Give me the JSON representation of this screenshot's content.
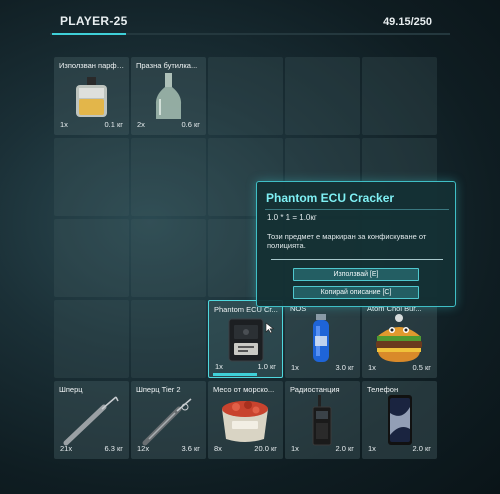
{
  "header": {
    "player_name": "PLAYER-25",
    "weight": "49.15/250"
  },
  "slots": [
    {
      "name": "Използван парфю...",
      "count": "1x",
      "weight": "0.1 кг",
      "icon": "perfume-bottle"
    },
    {
      "name": "Празна бутилка...",
      "count": "2x",
      "weight": "0.6 кг",
      "icon": "empty-glass-bottle"
    },
    {},
    {},
    {},
    {},
    {},
    {},
    {},
    {},
    {},
    {},
    {},
    {},
    {},
    {},
    {},
    {
      "name": "Phantom ECU Cr...",
      "count": "1x",
      "weight": "1.0 кг",
      "icon": "ecu-device",
      "selected": true
    },
    {
      "name": "NOS",
      "count": "1x",
      "weight": "3.0 кг",
      "icon": "nos-bottle"
    },
    {
      "name": "Atom Choi Bur...",
      "count": "1x",
      "weight": "0.5 кг",
      "icon": "burger"
    },
    {
      "name": "Шперц",
      "count": "21x",
      "weight": "6.3 кг",
      "icon": "lockpick"
    },
    {
      "name": "Шперц Tier 2",
      "count": "12x",
      "weight": "3.6 кг",
      "icon": "lockpick-tier2"
    },
    {
      "name": "Месо от морско...",
      "count": "8x",
      "weight": "20.0 кг",
      "icon": "meat-bucket"
    },
    {
      "name": "Радиостанция",
      "count": "1x",
      "weight": "2.0 кг",
      "icon": "radio"
    },
    {
      "name": "Телефон",
      "count": "1x",
      "weight": "2.0 кг",
      "icon": "phone"
    }
  ],
  "tooltip": {
    "title": "Phantom ECU Cracker",
    "formula": "1.0 * 1 = 1.0кг",
    "description": "Този предмет е маркиран за конфискуване от полицията.",
    "use_button": "Използвай [E]",
    "copy_button": "Копирай описание [C]"
  },
  "colors": {
    "accent": "#3fd0d8",
    "tooltip_title": "#7ff0f4"
  }
}
